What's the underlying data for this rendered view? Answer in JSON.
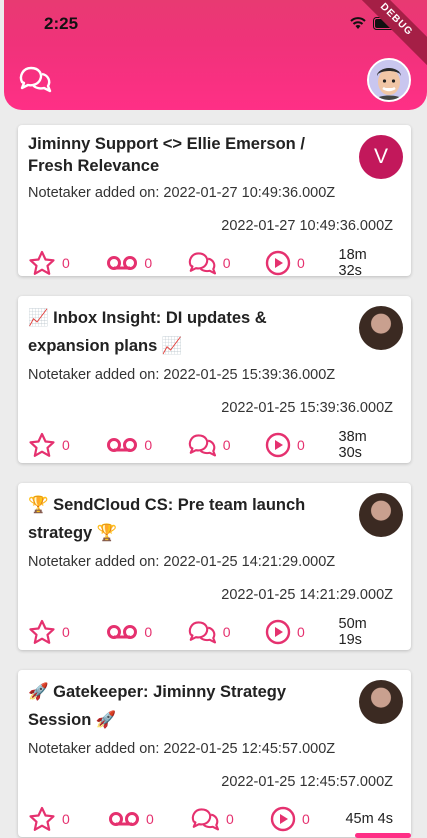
{
  "status": {
    "time": "2:25",
    "banner": "DEBUG"
  },
  "header": {
    "chat_icon": "chat-bubbles-icon",
    "avatar_icon": "profile-avatar"
  },
  "colors": {
    "brand": "#ff2f86",
    "accent": "#e5316f",
    "avatar_bg": "#c2185b"
  },
  "cards": [
    {
      "title": "Jiminny Support <> Ellie Emerson / Fresh Relevance",
      "avatar_letter": "V",
      "added": "Notetaker added on: 2022-01-27 10:49:36.000Z",
      "date": "2022-01-27 10:49:36.000Z",
      "stars": "0",
      "voicemail": "0",
      "comments": "0",
      "plays": "0",
      "duration": "18m 32s"
    },
    {
      "title": "📈 Inbox Insight: DI updates & expansion plans 📈",
      "avatar_letter": "",
      "added": "Notetaker added on: 2022-01-25 15:39:36.000Z",
      "date": "2022-01-25 15:39:36.000Z",
      "stars": "0",
      "voicemail": "0",
      "comments": "0",
      "plays": "0",
      "duration": "38m 30s"
    },
    {
      "title": "🏆 SendCloud CS: Pre team launch strategy 🏆",
      "avatar_letter": "",
      "added": "Notetaker added on: 2022-01-25 14:21:29.000Z",
      "date": "2022-01-25 14:21:29.000Z",
      "stars": "0",
      "voicemail": "0",
      "comments": "0",
      "plays": "0",
      "duration": "50m 19s"
    },
    {
      "title": "🚀 Gatekeeper: Jiminny Strategy Session 🚀",
      "avatar_letter": "",
      "added": "Notetaker added on: 2022-01-25 12:45:57.000Z",
      "date": "2022-01-25 12:45:57.000Z",
      "stars": "0",
      "voicemail": "0",
      "comments": "0",
      "plays": "0",
      "duration": "45m 4s"
    }
  ]
}
